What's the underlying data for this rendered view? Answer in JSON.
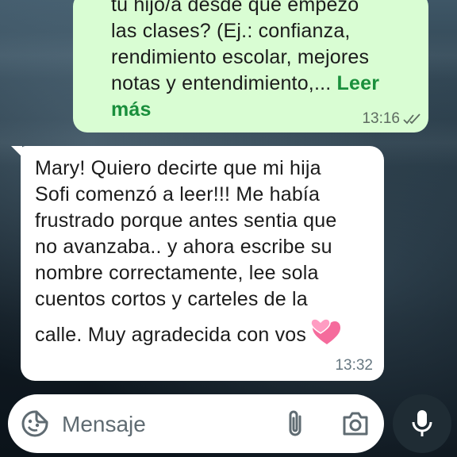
{
  "outgoing_message": {
    "lines": [
      "tu hijo/a desde que empezó",
      "las clases? (Ej.: confianza,",
      "rendimiento escolar, mejores",
      "notas y entendimiento,..."
    ],
    "read_more": "Leer",
    "read_more_2": "más",
    "time": "13:16",
    "status_icon": "double-check-icon"
  },
  "incoming_message": {
    "lines": [
      "Mary! Quiero decirte que mi hija",
      "Sofi comenzó a leer!!! Me había",
      "frustrado porque antes sentia que",
      "no avanzaba.. y ahora escribe su",
      "nombre correctamente, lee sola",
      "cuentos cortos y carteles de la",
      "calle. Muy agradecida con vos"
    ],
    "emoji": "two-hearts-icon",
    "time": "13:32"
  },
  "composer": {
    "placeholder": "Mensaje",
    "emoji_icon": "emoji-sticker-icon",
    "attach_icon": "paperclip-icon",
    "camera_icon": "camera-icon",
    "mic_icon": "microphone-icon"
  },
  "colors": {
    "outgoing_bubble": "#d9fdd3",
    "incoming_bubble": "#ffffff",
    "read_more": "#1a8f3c",
    "mic_button": "#1f2c34"
  }
}
